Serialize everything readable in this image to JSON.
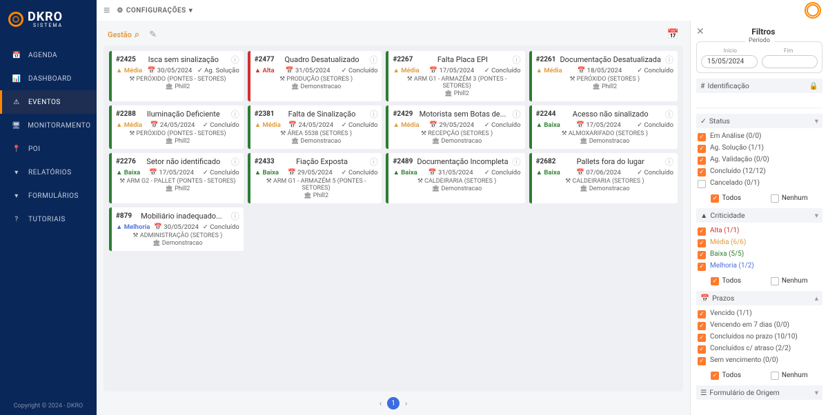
{
  "brand": {
    "name": "DKRO",
    "sub": "SISTEMA"
  },
  "topbar": {
    "config": "CONFIGURAÇÕES"
  },
  "sidebar": {
    "items": [
      {
        "icon": "📅",
        "label": "AGENDA"
      },
      {
        "icon": "📊",
        "label": "DASHBOARD"
      },
      {
        "icon": "⚠",
        "label": "EVENTOS",
        "active": true
      },
      {
        "icon": "🖥",
        "label": "MONITORAMENTO"
      },
      {
        "icon": "📍",
        "label": "POI"
      },
      {
        "icon": "▾",
        "label": "RELATÓRIOS"
      },
      {
        "icon": "▾",
        "label": "FORMULÁRIOS"
      },
      {
        "icon": "?",
        "label": "TUTORIAIS"
      }
    ],
    "copyright": "Copyright © 2024 - DKRO"
  },
  "tabs": {
    "gestao": "Gestão",
    "analytics_icon": "📈"
  },
  "cards": [
    {
      "id": "#2425",
      "title": "Isca sem sinalização",
      "sev": "Média",
      "sevClass": "media",
      "date": "30/05/2024",
      "status": "Ag. Solução",
      "loc": "PERÓXIDO (PONTES - SETORES)",
      "user": "Phill2"
    },
    {
      "id": "#2477",
      "title": "Quadro Desatualizado",
      "sev": "Alta",
      "sevClass": "alta",
      "date": "31/05/2024",
      "status": "Concluído",
      "loc": "PRODUÇÃO (SETORES )",
      "user": "Demonstracao"
    },
    {
      "id": "#2267",
      "title": "Falta Placa EPI",
      "sev": "Média",
      "sevClass": "media",
      "date": "17/05/2024",
      "status": "Concluído",
      "loc": "ARM G1 - ARMAZÉM 3 (PONTES - SETORES)",
      "user": "Phill2"
    },
    {
      "id": "#2261",
      "title": "Documentação Desatualizada",
      "sev": "Média",
      "sevClass": "media",
      "date": "18/05/2024",
      "status": "Concluído",
      "loc": "PERÓXIDO (SETORES )",
      "user": "Phill2"
    },
    {
      "id": "#2288",
      "title": "Iluminação Deficiente",
      "sev": "Média",
      "sevClass": "media",
      "date": "24/05/2024",
      "status": "Concluído",
      "loc": "PERÓXIDO (PONTES - SETORES)",
      "user": "Phill2"
    },
    {
      "id": "#2381",
      "title": "Falta de Sinalização",
      "sev": "Média",
      "sevClass": "media",
      "date": "24/05/2024",
      "status": "Concluído",
      "loc": "ÁREA 5538 (SETORES )",
      "user": "Demonstracao"
    },
    {
      "id": "#2429",
      "title": "Motorista sem Botas de...",
      "sev": "Média",
      "sevClass": "media",
      "date": "29/05/2024",
      "status": "Concluído",
      "loc": "RECEPÇÃO (SETORES )",
      "user": "Demonstracao"
    },
    {
      "id": "#2244",
      "title": "Acesso não sinalizado",
      "sev": "Baixa",
      "sevClass": "baixa",
      "date": "17/05/2024",
      "status": "Concluído",
      "loc": "ALMOXARIFADO (SETORES )",
      "user": "Demonstracao"
    },
    {
      "id": "#2276",
      "title": "Setor não identificado",
      "sev": "Baixa",
      "sevClass": "baixa",
      "date": "17/05/2024",
      "status": "Concluído",
      "loc": "ARM G2 - PALLET (PONTES - SETORES)",
      "user": "Phill2"
    },
    {
      "id": "#2433",
      "title": "Fiação Exposta",
      "sev": "Baixa",
      "sevClass": "baixa",
      "date": "29/05/2024",
      "status": "Concluído",
      "loc": "ARM G1 - ARMAZÉM 5 (PONTES - SETORES)",
      "user": "Phill2"
    },
    {
      "id": "#2489",
      "title": "Documentação Incompleta",
      "sev": "Baixa",
      "sevClass": "baixa",
      "date": "31/05/2024",
      "status": "Concluído",
      "loc": "CALDEIRARIA (SETORES )",
      "user": "Demonstracao"
    },
    {
      "id": "#2682",
      "title": "Pallets fora do lugar",
      "sev": "Baixa",
      "sevClass": "baixa",
      "date": "07/06/2024",
      "status": "Concluído",
      "loc": "CALDEIRARIA (SETORES )",
      "user": "Demonstracao"
    },
    {
      "id": "#879",
      "title": "Mobiliário inadequado...",
      "sev": "Melhoria",
      "sevClass": "melhoria",
      "date": "30/05/2024",
      "status": "Concluído",
      "loc": "ADMINISTRAÇÃO (SETORES )",
      "user": "Demonstracao"
    }
  ],
  "pager": {
    "page": "1"
  },
  "filters": {
    "title": "Filtros",
    "period": {
      "legend": "Período",
      "startLabel": "Início",
      "endLabel": "Fim",
      "start": "15/05/2024",
      "end": ""
    },
    "identificacao": {
      "title": "Identificação"
    },
    "status": {
      "title": "Status",
      "items": [
        {
          "label": "Em Análise (0/0)",
          "checked": true
        },
        {
          "label": "Ag. Solução (1/1)",
          "checked": true
        },
        {
          "label": "Ag. Validação (0/0)",
          "checked": true
        },
        {
          "label": "Concluído (12/12)",
          "checked": true
        },
        {
          "label": "Cancelado (0/1)",
          "checked": false
        }
      ]
    },
    "criticidade": {
      "title": "Criticidade",
      "items": [
        {
          "label": "Alta (1/1)",
          "cls": "crit-alta",
          "checked": true
        },
        {
          "label": "Média (6/6)",
          "cls": "crit-media",
          "checked": true
        },
        {
          "label": "Baixa (5/5)",
          "cls": "crit-baixa",
          "checked": true
        },
        {
          "label": "Melhoria (1/2)",
          "cls": "crit-melhoria",
          "checked": true
        }
      ]
    },
    "prazos": {
      "title": "Prazos",
      "items": [
        {
          "label": "Vencido (1/1)",
          "checked": true
        },
        {
          "label": "Vencendo em 7 dias (0/0)",
          "checked": true
        },
        {
          "label": "Concluídos no prazo (10/10)",
          "checked": true
        },
        {
          "label": "Concluídos c/ atraso (2/2)",
          "checked": true
        },
        {
          "label": "Sem vencimento (0/0)",
          "checked": true
        }
      ]
    },
    "formOrigem": {
      "title": "Formulário de Origem"
    },
    "all": "Todos",
    "none": "Nenhum"
  }
}
